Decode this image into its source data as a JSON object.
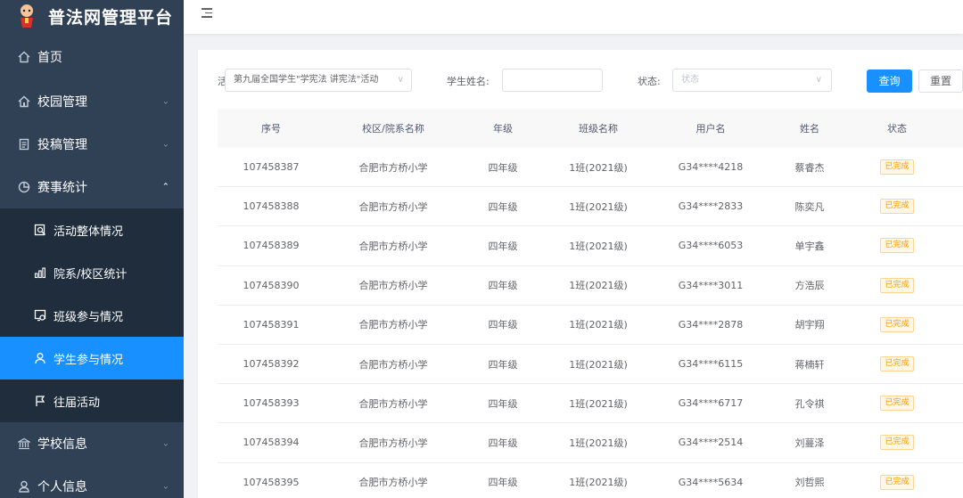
{
  "app": {
    "title": "普法网管理平台"
  },
  "sidebar": {
    "home": {
      "label": "首页",
      "icon": "home-icon"
    },
    "campus": {
      "label": "校园管理",
      "icon": "campus-icon"
    },
    "submission": {
      "label": "投稿管理",
      "icon": "document-icon"
    },
    "stats": {
      "label": "赛事统计",
      "icon": "pie-chart-icon"
    },
    "stats_items": [
      {
        "label": "活动整体情况",
        "icon": "search-doc-icon"
      },
      {
        "label": "院系/校区统计",
        "icon": "bar-chart-icon"
      },
      {
        "label": "班级参与情况",
        "icon": "class-icon"
      },
      {
        "label": "学生参与情况",
        "icon": "user-icon"
      },
      {
        "label": "往届活动",
        "icon": "flag-icon"
      }
    ],
    "school": {
      "label": "学校信息",
      "icon": "bank-icon"
    },
    "personal": {
      "label": "个人信息",
      "icon": "person-icon"
    }
  },
  "filters": {
    "activity_label": "活",
    "activity_value": "第九届全国学生\"学宪法 讲宪法\"活动",
    "student_name_label": "学生姓名:",
    "student_name_value": "",
    "status_label": "状态:",
    "status_placeholder": "状态",
    "query_button": "查询",
    "reset_button": "重置"
  },
  "table": {
    "headers": [
      "序号",
      "校区/院系名称",
      "年级",
      "班级名称",
      "用户名",
      "姓名",
      "状态"
    ],
    "rows": [
      [
        "107458387",
        "合肥市方桥小学",
        "四年级",
        "1班(2021级)",
        "G34****4218",
        "蔡睿杰",
        "已完成"
      ],
      [
        "107458388",
        "合肥市方桥小学",
        "四年级",
        "1班(2021级)",
        "G34****2833",
        "陈奕凡",
        "已完成"
      ],
      [
        "107458389",
        "合肥市方桥小学",
        "四年级",
        "1班(2021级)",
        "G34****6053",
        "单宇鑫",
        "已完成"
      ],
      [
        "107458390",
        "合肥市方桥小学",
        "四年级",
        "1班(2021级)",
        "G34****3011",
        "方浩辰",
        "已完成"
      ],
      [
        "107458391",
        "合肥市方桥小学",
        "四年级",
        "1班(2021级)",
        "G34****2878",
        "胡宇翔",
        "已完成"
      ],
      [
        "107458392",
        "合肥市方桥小学",
        "四年级",
        "1班(2021级)",
        "G34****6115",
        "蒋楠轩",
        "已完成"
      ],
      [
        "107458393",
        "合肥市方桥小学",
        "四年级",
        "1班(2021级)",
        "G34****6717",
        "孔令祺",
        "已完成"
      ],
      [
        "107458394",
        "合肥市方桥小学",
        "四年级",
        "1班(2021级)",
        "G34****2514",
        "刘蔓泽",
        "已完成"
      ],
      [
        "107458395",
        "合肥市方桥小学",
        "四年级",
        "1班(2021级)",
        "G34****5634",
        "刘哲熙",
        "已完成"
      ]
    ]
  },
  "colors": {
    "sidebar": "#304156",
    "submenu": "#1f2d3d",
    "accent": "#1890ff",
    "tag": "#ff9900"
  }
}
